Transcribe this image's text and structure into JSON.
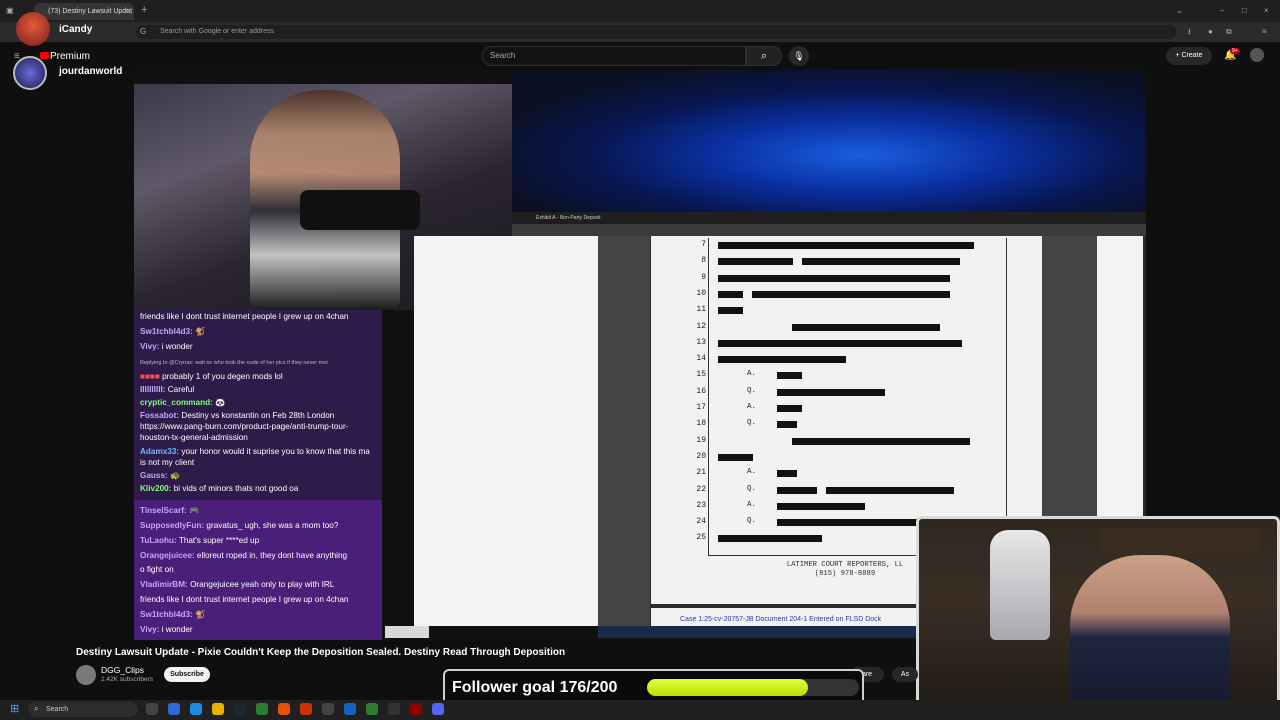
{
  "browser": {
    "tab_title": "(73) Destiny Lawsuit Updat",
    "url_placeholder": "Search with Google or enter address",
    "new_tab": "+"
  },
  "overlay": {
    "streamer_name": "iCandy",
    "premium_label": "Premium",
    "channel_handle": "jourdanworld"
  },
  "youtube": {
    "search_placeholder": "Search",
    "create_label": "+ Create",
    "notif_count": "9+"
  },
  "chat_top": [
    {
      "name": "",
      "text": "friends like I dont trust internet people I grew up on 4chan"
    },
    {
      "name": "Sw1tchbl4d3:",
      "text": "🐒"
    },
    {
      "name": "Vivy:",
      "text": "i wonder"
    },
    {
      "name": "",
      "text": "Replying to @Crynax: wait so who took the nude of her pics if they never met"
    },
    {
      "name": "",
      "text": "probably 1 of you degen mods lol"
    },
    {
      "name": "IIIIIIIIII:",
      "text": "Careful"
    },
    {
      "name": "cryptic_command:",
      "text": "🐼"
    },
    {
      "name": "Fossabot:",
      "text": "Destiny vs konstantin on Feb 28th London"
    },
    {
      "name": "",
      "text": "https://www.pang-burn.com/product-page/anti-trump-tour-"
    },
    {
      "name": "",
      "text": "houston-tx-general-admission"
    },
    {
      "name": "Adamx33:",
      "text": "your honor would it suprise you to know that this ma"
    },
    {
      "name": "",
      "text": "is not my client"
    },
    {
      "name": "Gauss:",
      "text": "🐢"
    },
    {
      "name": "Kliv200:",
      "text": "bi vids of minors thats not good oa"
    }
  ],
  "chat_bottom": [
    {
      "name": "TinselScarf:",
      "text": "🎮"
    },
    {
      "name": "SupposedlyFun:",
      "text": "gravatus_ ugh, she was a mom too?"
    },
    {
      "name": "TuLaohu:",
      "text": "That's super ****ed up"
    },
    {
      "name": "Orangejuicee:",
      "text": "elloreut roped in, they dont have anything"
    },
    {
      "name": "",
      "text": "o fight on"
    },
    {
      "name": "VladimirBM:",
      "text": "Orangejuicee yeah only to play with IRL"
    },
    {
      "name": "",
      "text": "friends like I dont trust internet people I grew up on 4chan"
    },
    {
      "name": "Sw1tchbl4d3:",
      "text": "🐒"
    },
    {
      "name": "Vivy:",
      "text": "i wonder"
    }
  ],
  "document": {
    "line_numbers": [
      "7",
      "8",
      "9",
      "10",
      "11",
      "12",
      "13",
      "14",
      "15",
      "16",
      "17",
      "18",
      "19",
      "20",
      "21",
      "22",
      "23",
      "24",
      "25"
    ],
    "qa_marks": [
      "A.",
      "Q.",
      "A.",
      "Q.",
      "A.",
      "Q.",
      "A.",
      "Q."
    ],
    "reporter_name": "LATIMER COURT REPORTERS, LL",
    "reporter_phone": "(815) 978-8889",
    "case_footer": "Case 1:25-cv-20757-JB   Document 204-1   Entered on FLSD Dock",
    "doc_tab": "Exhibit A - Non-Party Deposit"
  },
  "video": {
    "title": "Destiny Lawsuit Update - Pixie Couldn't Keep the Deposition Sealed. Destiny Read Through Deposition",
    "channel": "DGG_Clips",
    "subscribers": "2.42K subscribers",
    "subscribe_label": "Subscribe",
    "share_label": "are",
    "ask_label": "As"
  },
  "follower_goal": {
    "label": "Follower goal 176/200",
    "current": 176,
    "target": 200
  },
  "taskbar": {
    "search_label": "Search"
  },
  "colors": {
    "goal_fill": "#c8f000",
    "chat_bg_top": "#2e1b4a",
    "chat_bg_bottom": "#4a1f7a"
  }
}
